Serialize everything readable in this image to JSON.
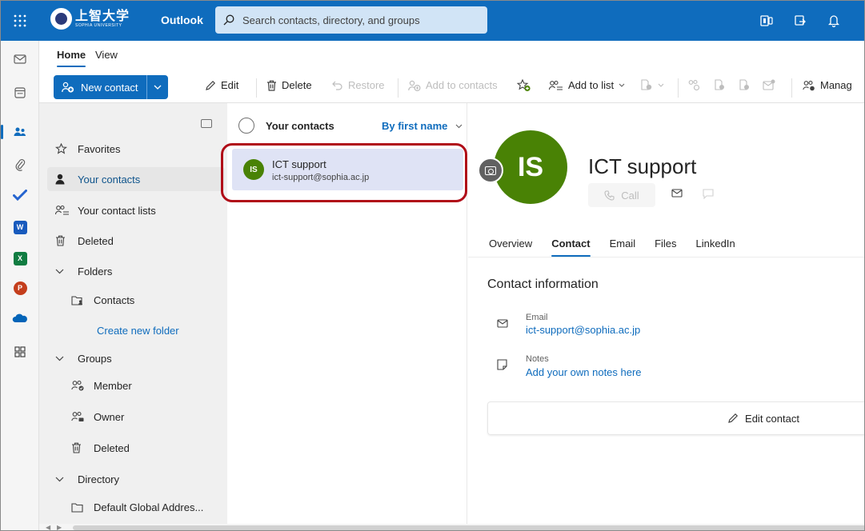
{
  "header": {
    "logo_jp": "上智大学",
    "logo_en": "SOPHIA UNIVERSITY",
    "app_name": "Outlook",
    "search_placeholder": "Search contacts, directory, and groups"
  },
  "ribbon": {
    "tabs": [
      "Home",
      "View"
    ],
    "new_contact": "New contact",
    "edit": "Edit",
    "delete": "Delete",
    "restore": "Restore",
    "add_to_contacts": "Add to contacts",
    "add_to_list": "Add to list",
    "manage": "Manag"
  },
  "nav": {
    "favorites": "Favorites",
    "your_contacts": "Your contacts",
    "your_contact_lists": "Your contact lists",
    "deleted": "Deleted",
    "folders": "Folders",
    "contacts_folder": "Contacts",
    "create_new_folder": "Create new folder",
    "groups": "Groups",
    "member": "Member",
    "owner": "Owner",
    "groups_deleted": "Deleted",
    "directory": "Directory",
    "default_global": "Default Global Addres..."
  },
  "list": {
    "title": "Your contacts",
    "sort": "By first name",
    "contacts": [
      {
        "initials": "IS",
        "name": "ICT support",
        "email": "ict-support@sophia.ac.jp"
      }
    ]
  },
  "detail": {
    "initials": "IS",
    "name": "ICT support",
    "call": "Call",
    "tabs": [
      "Overview",
      "Contact",
      "Email",
      "Files",
      "LinkedIn"
    ],
    "section_title": "Contact information",
    "email_label": "Email",
    "email_value": "ict-support@sophia.ac.jp",
    "notes_label": "Notes",
    "notes_value": "Add your own notes here",
    "edit_contact": "Edit contact"
  },
  "colors": {
    "brand": "#0f6cbd",
    "avatar": "#498205",
    "highlight": "#b00d18"
  }
}
